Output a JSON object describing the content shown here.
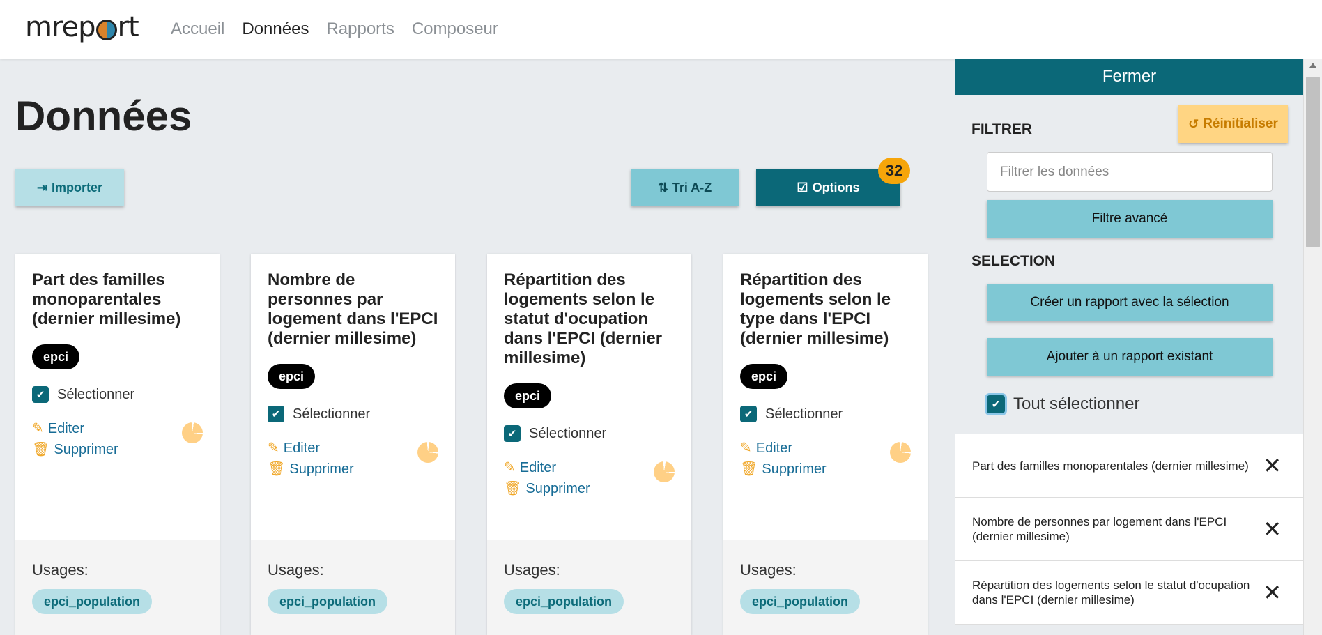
{
  "app": {
    "logo_text": "mreport"
  },
  "nav": {
    "items": [
      {
        "label": "Accueil",
        "active": false
      },
      {
        "label": "Données",
        "active": true
      },
      {
        "label": "Rapports",
        "active": false
      },
      {
        "label": "Composeur",
        "active": false
      }
    ]
  },
  "page": {
    "title": "Données"
  },
  "toolbar": {
    "import_label": "Importer",
    "sort_label": "Tri A-Z",
    "options_label": "Options",
    "options_count": "32"
  },
  "cards": [
    {
      "title": "Part des familles monoparentales (dernier millesime)",
      "tag": "epci",
      "select_label": "Sélectionner",
      "edit_label": "Editer",
      "delete_label": "Supprimer",
      "usages_label": "Usages:",
      "usage": "epci_population"
    },
    {
      "title": "Nombre de personnes par logement dans l'EPCI (dernier millesime)",
      "tag": "epci",
      "select_label": "Sélectionner",
      "edit_label": "Editer",
      "delete_label": "Supprimer",
      "usages_label": "Usages:",
      "usage": "epci_population"
    },
    {
      "title": "Répartition des logements selon le statut d'ocupation dans l'EPCI (dernier millesime)",
      "tag": "epci",
      "select_label": "Sélectionner",
      "edit_label": "Editer",
      "delete_label": "Supprimer",
      "usages_label": "Usages:",
      "usage": "epci_population"
    },
    {
      "title": "Répartition des logements selon le type dans l'EPCI (dernier millesime)",
      "tag": "epci",
      "select_label": "Sélectionner",
      "edit_label": "Editer",
      "delete_label": "Supprimer",
      "usages_label": "Usages:",
      "usage": "epci_population"
    }
  ],
  "sidebar": {
    "close_label": "Fermer",
    "filter_heading": "FILTRER",
    "reset_label": "Réinitialiser",
    "filter_placeholder": "Filtrer les données",
    "advanced_filter_label": "Filtre avancé",
    "selection_heading": "SELECTION",
    "create_report_label": "Créer un rapport avec la sélection",
    "add_to_report_label": "Ajouter à un rapport existant",
    "select_all_label": "Tout sélectionner",
    "selected_items": [
      "Part des familles monoparentales (dernier millesime)",
      "Nombre de personnes par logement dans l'EPCI (dernier millesime)",
      "Répartition des logements selon le statut d'ocupation dans l'EPCI (dernier millesime)"
    ]
  },
  "colors": {
    "primary": "#0b6878",
    "info": "#7fc8d4",
    "warning": "#f6a50a",
    "accent_icon": "#f0a728"
  }
}
